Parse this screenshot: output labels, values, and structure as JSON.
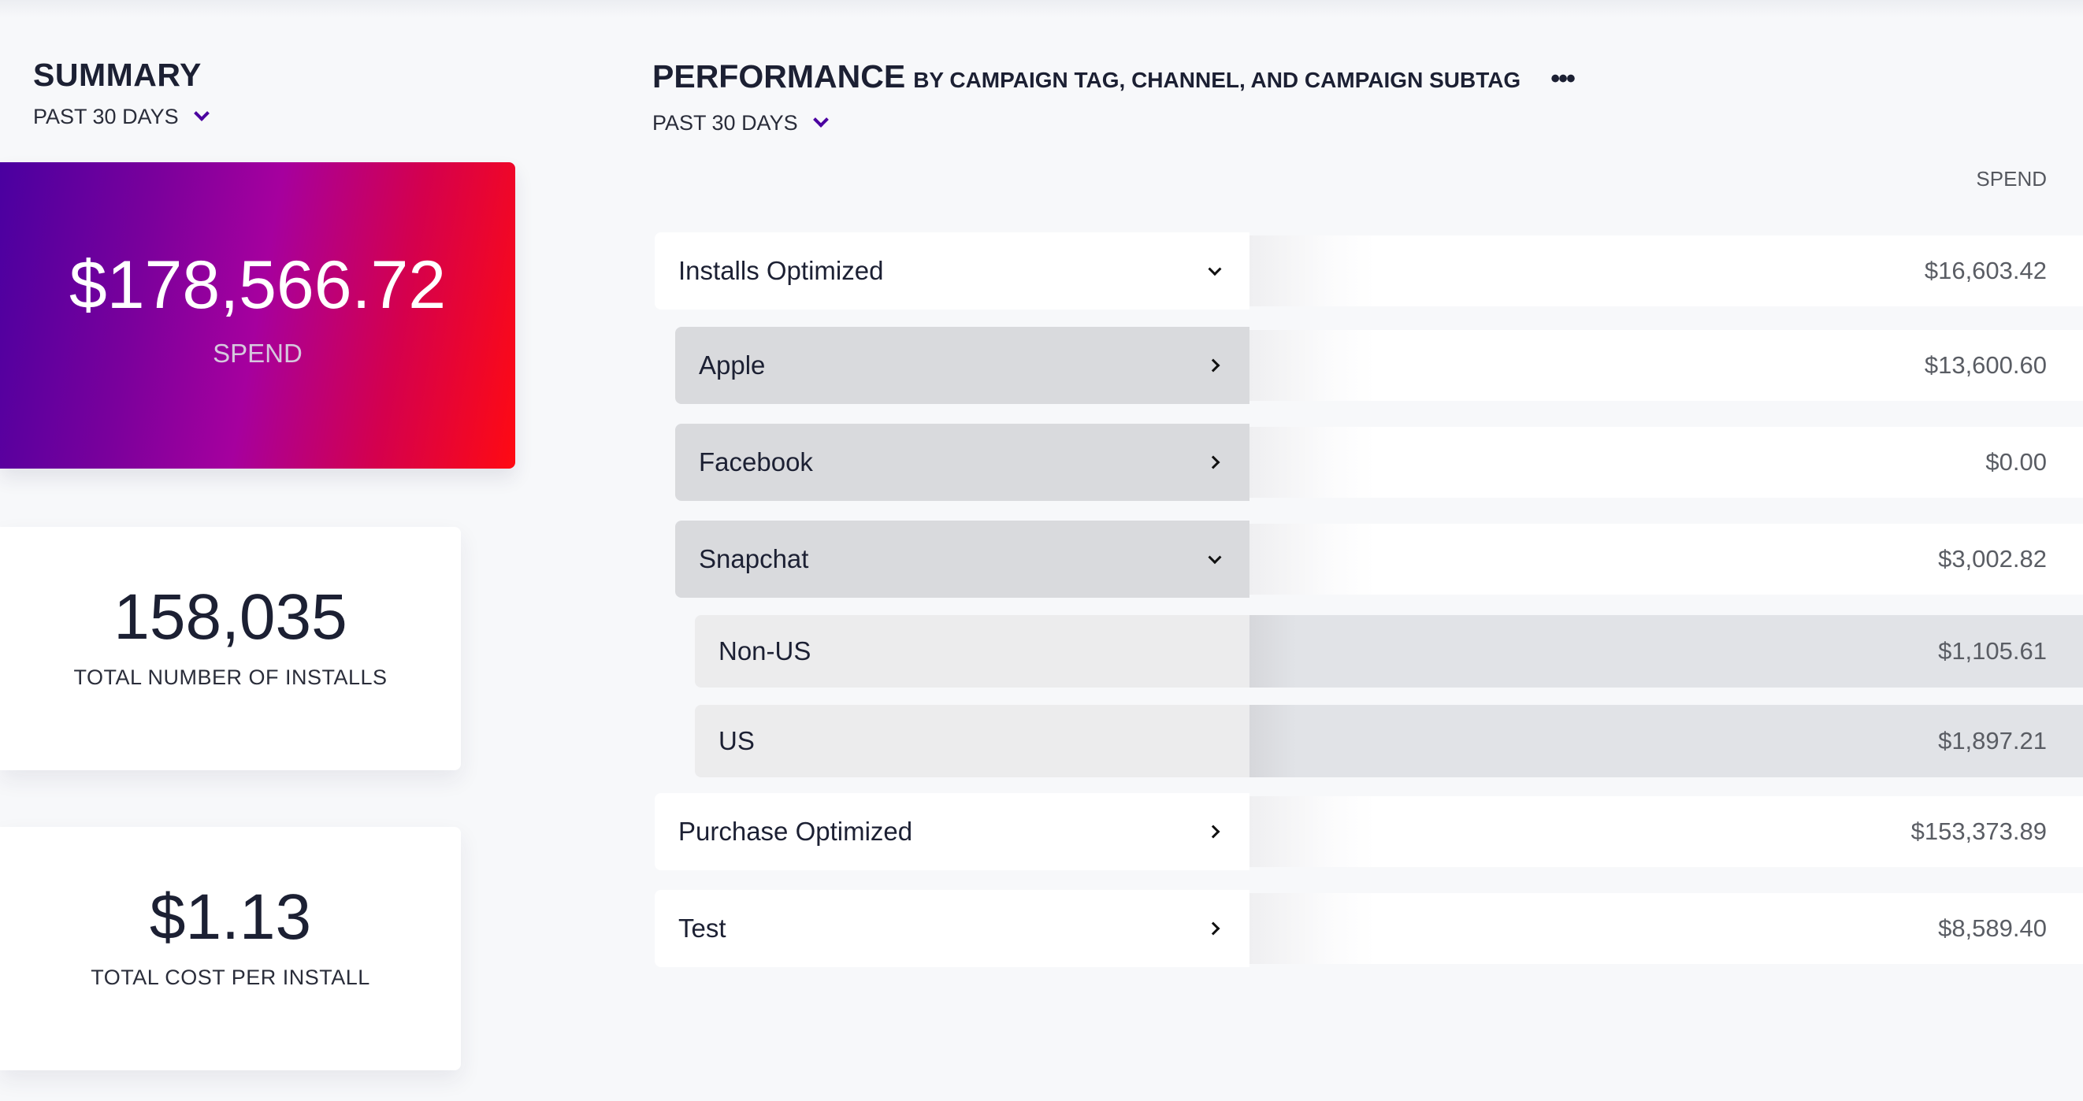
{
  "summary": {
    "title": "SUMMARY",
    "period": "PAST 30 DAYS",
    "spend": {
      "value": "$178,566.72",
      "label": "SPEND"
    },
    "installs": {
      "value": "158,035",
      "label": "TOTAL NUMBER OF INSTALLS"
    },
    "cpi": {
      "value": "$1.13",
      "label": "TOTAL COST PER INSTALL"
    }
  },
  "colors": {
    "gradient_start": "#4a00a0",
    "gradient_mid": "#a6009e",
    "gradient_end": "#ff0a12",
    "accent": "#4b00a0"
  },
  "performance": {
    "title": "PERFORMANCE",
    "subtitle": "BY CAMPAIGN TAG, CHANNEL, AND CAMPAIGN SUBTAG",
    "more_icon": "ellipsis-icon",
    "more_label": "•••",
    "period": "PAST 30 DAYS",
    "column_header": "SPEND",
    "rows": [
      {
        "label": "Installs Optimized",
        "value": "$16,603.42",
        "level": 0,
        "icon": "chevron-down-icon",
        "expanded": true
      },
      {
        "label": "Apple",
        "value": "$13,600.60",
        "level": 1,
        "icon": "chevron-right-icon",
        "expanded": false
      },
      {
        "label": "Facebook",
        "value": "$0.00",
        "level": 1,
        "icon": "chevron-right-icon",
        "expanded": false
      },
      {
        "label": "Snapchat",
        "value": "$3,002.82",
        "level": 1,
        "icon": "chevron-down-icon",
        "expanded": true
      },
      {
        "label": "Non-US",
        "value": "$1,105.61",
        "level": 2
      },
      {
        "label": "US",
        "value": "$1,897.21",
        "level": 2
      },
      {
        "label": "Purchase Optimized",
        "value": "$153,373.89",
        "level": 0,
        "icon": "chevron-right-icon",
        "expanded": false
      },
      {
        "label": "Test",
        "value": "$8,589.40",
        "level": 0,
        "icon": "chevron-right-icon",
        "expanded": false
      }
    ]
  }
}
